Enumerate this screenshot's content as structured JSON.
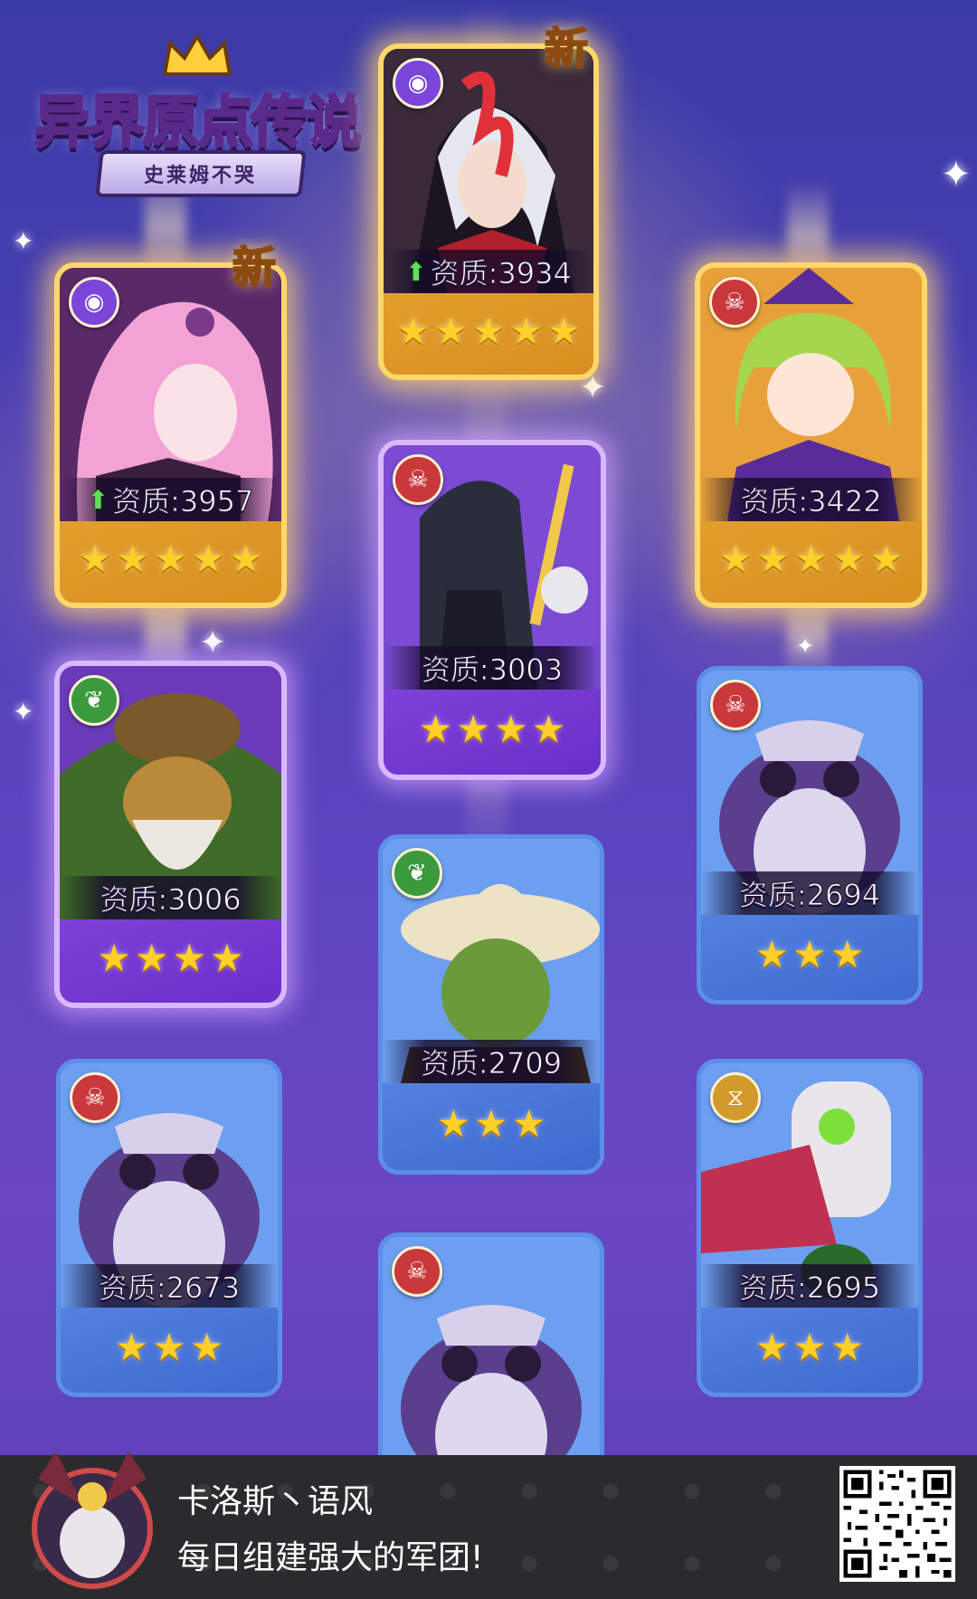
{
  "logo": {
    "title": "异界原点传说",
    "subtitle": "史莱姆不哭"
  },
  "new_tag": "新",
  "cards": [
    {
      "id": "card-1",
      "rarity": "gold",
      "element": "eye-icon",
      "quality": "资质:3934",
      "upgraded": true,
      "stars": 5,
      "is_new": true
    },
    {
      "id": "card-2",
      "rarity": "gold",
      "element": "eye-icon",
      "quality": "资质:3957",
      "upgraded": true,
      "stars": 5,
      "is_new": true
    },
    {
      "id": "card-3",
      "rarity": "gold",
      "element": "skull-icon",
      "quality": "资质:3422",
      "upgraded": false,
      "stars": 5,
      "is_new": false
    },
    {
      "id": "card-4",
      "rarity": "purple",
      "element": "skull-icon",
      "quality": "资质:3003",
      "upgraded": false,
      "stars": 4,
      "is_new": false
    },
    {
      "id": "card-5",
      "rarity": "purple",
      "element": "leaf-icon",
      "quality": "资质:3006",
      "upgraded": false,
      "stars": 4,
      "is_new": false
    },
    {
      "id": "card-6",
      "rarity": "blue",
      "element": "skull-icon",
      "quality": "资质:2694",
      "upgraded": false,
      "stars": 3,
      "is_new": false
    },
    {
      "id": "card-7",
      "rarity": "blue",
      "element": "leaf-icon",
      "quality": "资质:2709",
      "upgraded": false,
      "stars": 3,
      "is_new": false
    },
    {
      "id": "card-8",
      "rarity": "blue",
      "element": "skull-icon",
      "quality": "资质:2673",
      "upgraded": false,
      "stars": 3,
      "is_new": false
    },
    {
      "id": "card-9",
      "rarity": "blue",
      "element": "gold-element-icon",
      "quality": "资质:2695",
      "upgraded": false,
      "stars": 3,
      "is_new": false
    },
    {
      "id": "card-10",
      "rarity": "blue",
      "element": "skull-icon",
      "quality": "",
      "upgraded": false,
      "stars": 0,
      "is_new": false
    }
  ],
  "footer": {
    "username": "卡洛斯丶语风",
    "slogan": "每日组建强大的军团!",
    "qr_icon": "qr-code-icon"
  },
  "colors": {
    "gold_border": "#ffd76a",
    "purple_border": "#d9b8ff",
    "blue_border": "#5c8fe8",
    "star": "#ffd02a",
    "upgrade_arrow": "#5fe05a"
  }
}
